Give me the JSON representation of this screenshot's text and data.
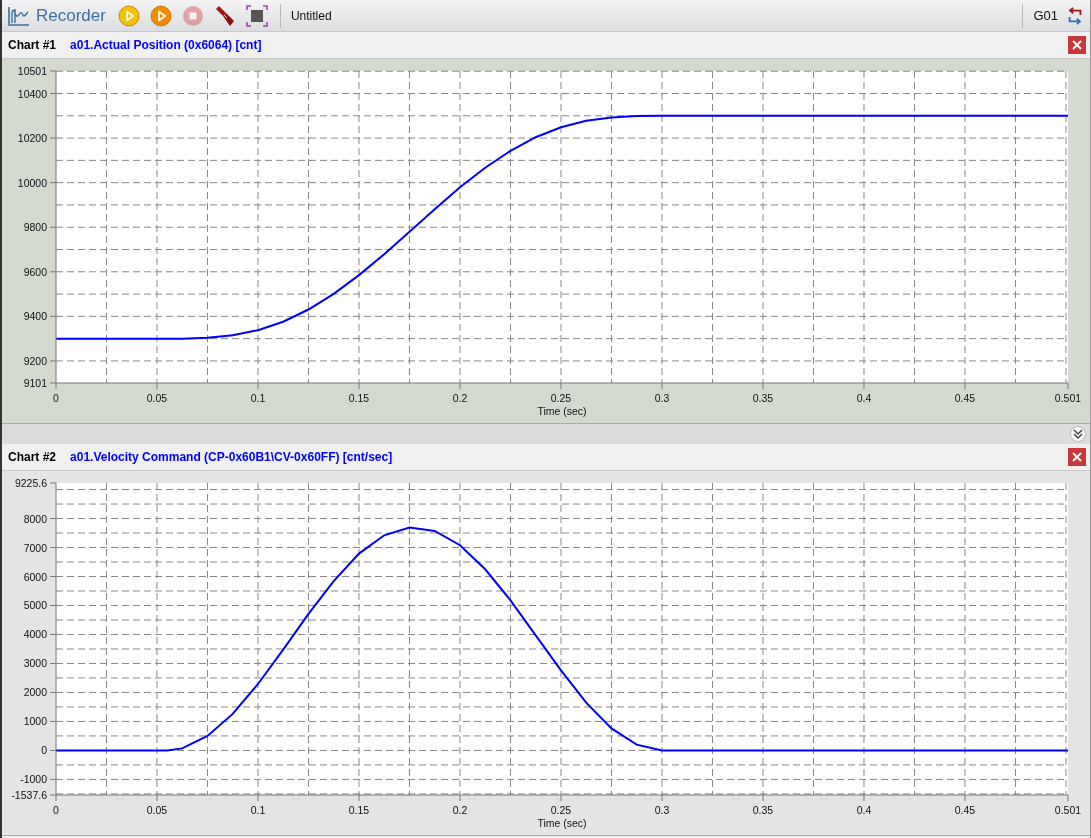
{
  "toolbar": {
    "title": "Recorder",
    "buttons": [
      {
        "kind": "start",
        "disabled": false
      },
      {
        "kind": "play",
        "disabled": false
      },
      {
        "kind": "stop",
        "disabled": true
      },
      {
        "kind": "clear",
        "disabled": false
      },
      {
        "kind": "zoom",
        "disabled": false
      }
    ],
    "document": "Untitled",
    "group": "G01"
  },
  "charts": [
    {
      "number": "Chart #1",
      "chart_data": {
        "type": "line",
        "xlabel": "Time (sec)",
        "x": [
          0,
          0.0125,
          0.025,
          0.0375,
          0.05,
          0.0625,
          0.075,
          0.0875,
          0.1,
          0.1125,
          0.125,
          0.1375,
          0.15,
          0.1625,
          0.175,
          0.1875,
          0.2,
          0.2125,
          0.225,
          0.2375,
          0.25,
          0.2625,
          0.275,
          0.2875,
          0.3,
          0.35,
          0.4,
          0.45,
          0.5,
          0.501
        ],
        "series": [
          {
            "name": "a01.Actual Position (0x6064) [cnt]",
            "color": "#0000ff",
            "values": [
              9300,
              9300,
              9300,
              9300,
              9300,
              9300,
              9304,
              9315,
              9338,
              9376,
              9431,
              9501,
              9585,
              9679,
              9780,
              9881,
              9979,
              10067,
              10143,
              10204,
              10249,
              10278,
              10293,
              10299,
              10300,
              10300,
              10300,
              10300,
              10300,
              10300
            ]
          }
        ],
        "xlim": [
          0,
          0.501
        ],
        "ylim": [
          9101,
          10501
        ],
        "grid": true,
        "xticks": [
          0,
          0.05,
          0.1,
          0.15,
          0.2,
          0.25,
          0.3,
          0.35,
          0.4,
          0.45,
          0.501
        ],
        "yticks": [
          9101,
          9200,
          9400,
          9600,
          9800,
          10000,
          10200,
          10400,
          10501
        ]
      }
    },
    {
      "number": "Chart #2",
      "chart_data": {
        "type": "line",
        "xlabel": "Time (sec)",
        "x": [
          0,
          0.0125,
          0.025,
          0.0375,
          0.05,
          0.055,
          0.0625,
          0.075,
          0.0875,
          0.1,
          0.1125,
          0.125,
          0.1375,
          0.15,
          0.1625,
          0.175,
          0.1875,
          0.2,
          0.2125,
          0.225,
          0.2375,
          0.25,
          0.2625,
          0.275,
          0.2875,
          0.3,
          0.35,
          0.4,
          0.45,
          0.5,
          0.501
        ],
        "series": [
          {
            "name": "a01.Velocity Command (CP-0x60B1\\CV-0x60FF) [cnt/sec]",
            "color": "#0000ff",
            "values": [
              0,
              0,
              0,
              0,
              0,
              0,
              70,
              500,
              1260,
              2290,
              3480,
              4710,
              5840,
              6790,
              7420,
              7690,
              7570,
              7080,
              6250,
              5180,
              3970,
              2760,
              1650,
              760,
              200,
              0,
              0,
              0,
              0,
              0,
              0
            ]
          }
        ],
        "xlim": [
          0,
          0.501
        ],
        "ylim": [
          -1537.6,
          9225.6
        ],
        "grid": true,
        "xticks": [
          0,
          0.05,
          0.1,
          0.15,
          0.2,
          0.25,
          0.3,
          0.35,
          0.4,
          0.45,
          0.501
        ],
        "yticks": [
          -1537.6,
          -1000,
          0,
          1000,
          2000,
          3000,
          4000,
          5000,
          6000,
          7000,
          8000,
          9225.6
        ]
      }
    }
  ]
}
